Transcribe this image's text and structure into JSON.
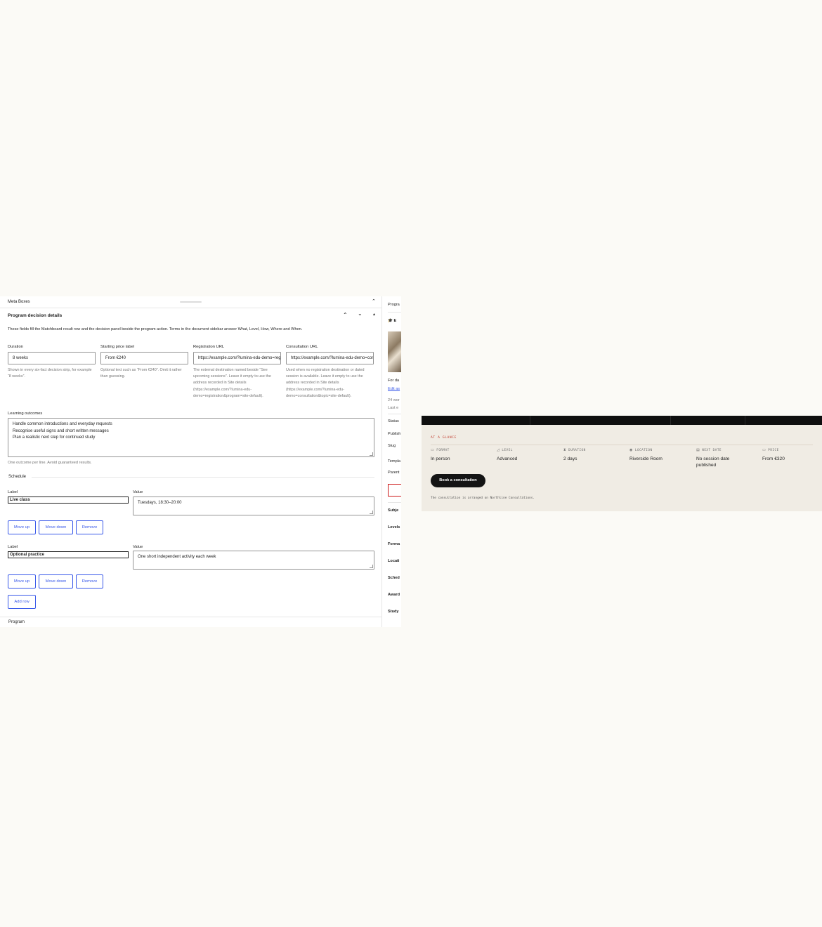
{
  "meta_boxes": {
    "title": "Meta Boxes"
  },
  "panel": {
    "title": "Program decision details",
    "description": "These fields fill the Matchboard result row and the decision panel beside the program action. Terms in the document sidebar answer What, Level, How, Where and When."
  },
  "fields": [
    {
      "label": "Duration",
      "value": "8 weeks",
      "help": "Shown in every six-fact decision strip, for example “8 weeks”."
    },
    {
      "label": "Starting price label",
      "value": "From €240",
      "help": "Optional text such as “From €240”. Omit it rather than guessing."
    },
    {
      "label": "Registration URL",
      "value": "https://example.com/?lumina-edu-demo=registration&program=site-default",
      "help": "The external destination named beside “See upcoming sessions”. Leave it empty to use the address recorded in Site details (https://example.com/?lumina-edu-demo=registration&program=site-default)."
    },
    {
      "label": "Consultation URL",
      "value": "https://example.com/?lumina-edu-demo=consultation&topic=site-default",
      "help": "Used when no registration destination or dated session is available. Leave it empty to use the address recorded in Site details (https://example.com/?lumina-edu-demo=consultation&topic=site-default)."
    }
  ],
  "outcomes": {
    "label": "Learning outcomes",
    "lines": [
      "Handle common introductions and everyday requests",
      "Recognise useful signs and short written messages",
      "Plan a realistic next step for continued study"
    ],
    "help": "One outcome per line. Avoid guaranteed results."
  },
  "schedule": {
    "title": "Schedule",
    "label_title": "Label",
    "value_title": "Value",
    "rows": [
      {
        "label": "Live class",
        "value": "Tuesdays, 18:30–20:00"
      },
      {
        "label": "Optional practice",
        "value": "One short independent activity each week"
      }
    ],
    "move_up": "Move up",
    "move_down": "Move down",
    "remove": "Remove",
    "add_row": "Add row"
  },
  "footer": {
    "breadcrumb": "Program"
  },
  "sidebar": {
    "tab": "Progra",
    "block": "E",
    "for_date": "For da",
    "edit": "Edit as",
    "words": "24 wor",
    "last": "Last e",
    "status": "Status",
    "publish": "Publish",
    "slug": "Slug",
    "template": "Templa",
    "parent": "Parent",
    "subject": "Subje",
    "levels": "Levels",
    "format": "Forma",
    "location": "Locati",
    "schedule": "Sched",
    "award": "Award",
    "study": "Study"
  },
  "glance": {
    "eyebrow": "AT A GLANCE",
    "items": [
      {
        "key": "FORMAT",
        "icon": "monitor-icon",
        "glyph": "▭",
        "value": "In person"
      },
      {
        "key": "LEVEL",
        "icon": "signal-bars-icon",
        "glyph": "◿",
        "value": "Advanced"
      },
      {
        "key": "DURATION",
        "icon": "hourglass-icon",
        "glyph": "⧗",
        "value": "2 days"
      },
      {
        "key": "LOCATION",
        "icon": "location-pin-icon",
        "glyph": "◉",
        "value": "Riverside Room"
      },
      {
        "key": "NEXT DATE",
        "icon": "calendar-icon",
        "glyph": "▤",
        "value": "No session date published"
      },
      {
        "key": "PRICE",
        "icon": "ticket-icon",
        "glyph": "▭",
        "value": "From €320"
      }
    ],
    "cta": "Book a consultation",
    "note": "The consultation is arranged on Northline Consultations."
  }
}
